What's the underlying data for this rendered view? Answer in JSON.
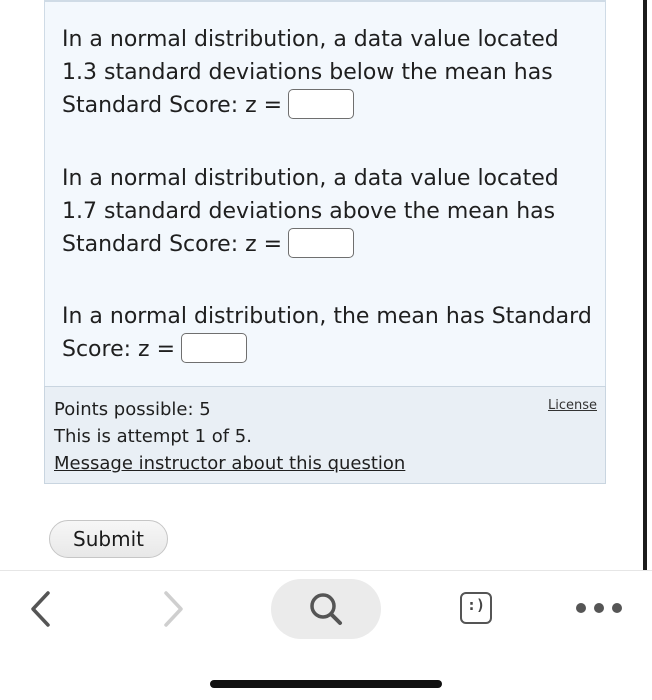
{
  "question": {
    "parts": [
      {
        "lines": [
          "In a normal distribution, a data value located",
          "1.3 standard deviations below the mean has"
        ],
        "prompt": "Standard Score: z =",
        "answer_value": ""
      },
      {
        "lines": [
          "In a normal distribution, a data value located",
          "1.7 standard deviations above the mean has"
        ],
        "prompt": "Standard Score: z =",
        "answer_value": ""
      },
      {
        "lines": [
          "In a normal distribution, the mean has Standard"
        ],
        "prompt": "Score: z =",
        "answer_value": ""
      }
    ]
  },
  "info": {
    "points": "Points possible: 5",
    "attempt": "This is attempt 1 of 5.",
    "message_link": "Message instructor about this question",
    "license_link": "License"
  },
  "submit": {
    "label": "Submit"
  },
  "toolbar": {
    "back_icon": "chevron-left-icon",
    "forward_icon": "chevron-right-icon",
    "search_icon": "search-icon",
    "emoji_glyph": ":)",
    "more_icon": "more-dots-icon",
    "active_color": "#555555",
    "disabled_color": "#cfcfcf"
  }
}
